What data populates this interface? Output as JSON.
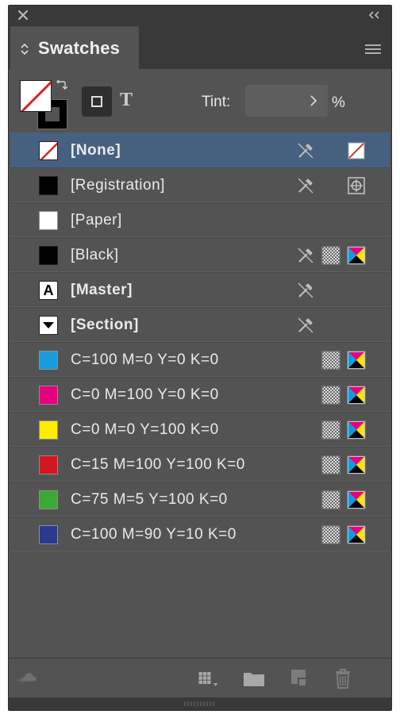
{
  "panel": {
    "tab_label": "Swatches"
  },
  "controls": {
    "tint_label": "Tint:",
    "tint_value": "",
    "tint_unit": "%",
    "text_button": "T"
  },
  "swatches": [
    {
      "label": "[None]",
      "chip": "none",
      "bold": true,
      "selected": true,
      "pencil_icon": "cross-pencil-icon",
      "mode_icon": "none-mode-icon"
    },
    {
      "label": "[Registration]",
      "chip": "#000000",
      "bold": false,
      "pencil_icon": "cross-pencil-icon",
      "mode_icon": "registration-icon"
    },
    {
      "label": "[Paper]",
      "chip": "#ffffff",
      "bold": false
    },
    {
      "label": "[Black]",
      "chip": "#000000",
      "bold": false,
      "pencil_icon": "cross-pencil-icon",
      "process_icon": "process-color-icon",
      "mode_icon": "cmyk-icon"
    },
    {
      "label": "[Master]",
      "chip": "master",
      "chip_letter": "A",
      "bold": true,
      "pencil_icon": "cross-pencil-icon"
    },
    {
      "label": "[Section]",
      "chip": "section",
      "bold": true,
      "pencil_icon": "cross-pencil-icon"
    },
    {
      "label": "C=100 M=0 Y=0 K=0",
      "chip": "#1a9bdc",
      "bold": false,
      "process_icon": "process-color-icon",
      "mode_icon": "cmyk-icon"
    },
    {
      "label": "C=0 M=100 Y=0 K=0",
      "chip": "#e6007e",
      "bold": false,
      "process_icon": "process-color-icon",
      "mode_icon": "cmyk-icon"
    },
    {
      "label": "C=0 M=0 Y=100 K=0",
      "chip": "#ffed00",
      "bold": false,
      "process_icon": "process-color-icon",
      "mode_icon": "cmyk-icon"
    },
    {
      "label": "C=15 M=100 Y=100 K=0",
      "chip": "#d2171f",
      "bold": false,
      "process_icon": "process-color-icon",
      "mode_icon": "cmyk-icon"
    },
    {
      "label": "C=75 M=5 Y=100 K=0",
      "chip": "#3aa935",
      "bold": false,
      "process_icon": "process-color-icon",
      "mode_icon": "cmyk-icon"
    },
    {
      "label": "C=100 M=90 Y=10 K=0",
      "chip": "#2b3a8f",
      "bold": false,
      "process_icon": "process-color-icon",
      "mode_icon": "cmyk-icon"
    }
  ],
  "footer": {
    "icons": [
      "cc-library-icon",
      "swatch-views-icon",
      "new-color-group-icon",
      "new-swatch-icon",
      "delete-swatch-icon"
    ]
  },
  "colors": {
    "panel_bg": "#535353",
    "selection": "#46617f",
    "header_bg": "#393939"
  }
}
